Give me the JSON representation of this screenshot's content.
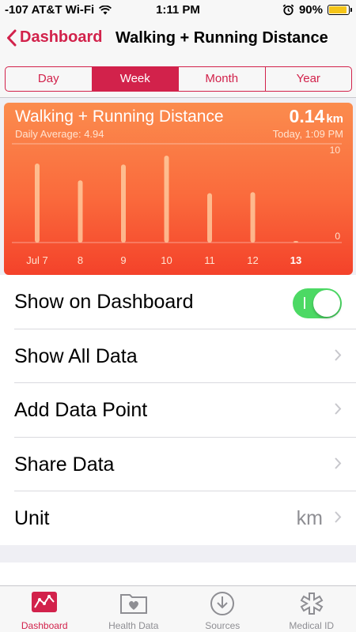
{
  "status_bar": {
    "carrier": "-107 AT&T Wi-Fi",
    "time": "1:11 PM",
    "battery": "90%",
    "battery_level": 0.9
  },
  "nav": {
    "back_label": "Dashboard",
    "title": "Walking + Running Distance"
  },
  "segments": [
    {
      "label": "Day",
      "active": false
    },
    {
      "label": "Week",
      "active": true
    },
    {
      "label": "Month",
      "active": false
    },
    {
      "label": "Year",
      "active": false
    }
  ],
  "card": {
    "title": "Walking + Running Distance",
    "value": "0.14",
    "unit": "km",
    "daily_average": "Daily Average: 4.94",
    "timestamp": "Today, 1:09 PM"
  },
  "chart_data": {
    "type": "bar",
    "categories": [
      "Jul 7",
      "8",
      "9",
      "10",
      "11",
      "12",
      "13"
    ],
    "values": [
      8.0,
      6.3,
      7.9,
      8.8,
      5.0,
      5.1,
      0.14
    ],
    "ylim": [
      0,
      10
    ],
    "y_tick_labels": [
      "10",
      "0"
    ],
    "highlight_category": "13",
    "grid": true
  },
  "settings": {
    "show_on_dashboard": "Show on Dashboard",
    "show_all_data": "Show All Data",
    "add_data_point": "Add Data Point",
    "share_data": "Share Data",
    "unit_label": "Unit",
    "unit_value": "km"
  },
  "tabs": [
    {
      "label": "Dashboard",
      "icon": "dashboard-icon",
      "active": true
    },
    {
      "label": "Health Data",
      "icon": "health-data-icon",
      "active": false
    },
    {
      "label": "Sources",
      "icon": "sources-icon",
      "active": false
    },
    {
      "label": "Medical ID",
      "icon": "medical-id-icon",
      "active": false
    }
  ],
  "colors": {
    "accent": "#d2224b",
    "toggle_on": "#4cd964",
    "card_top": "#fb8c4e",
    "card_bottom": "#f4422a"
  }
}
